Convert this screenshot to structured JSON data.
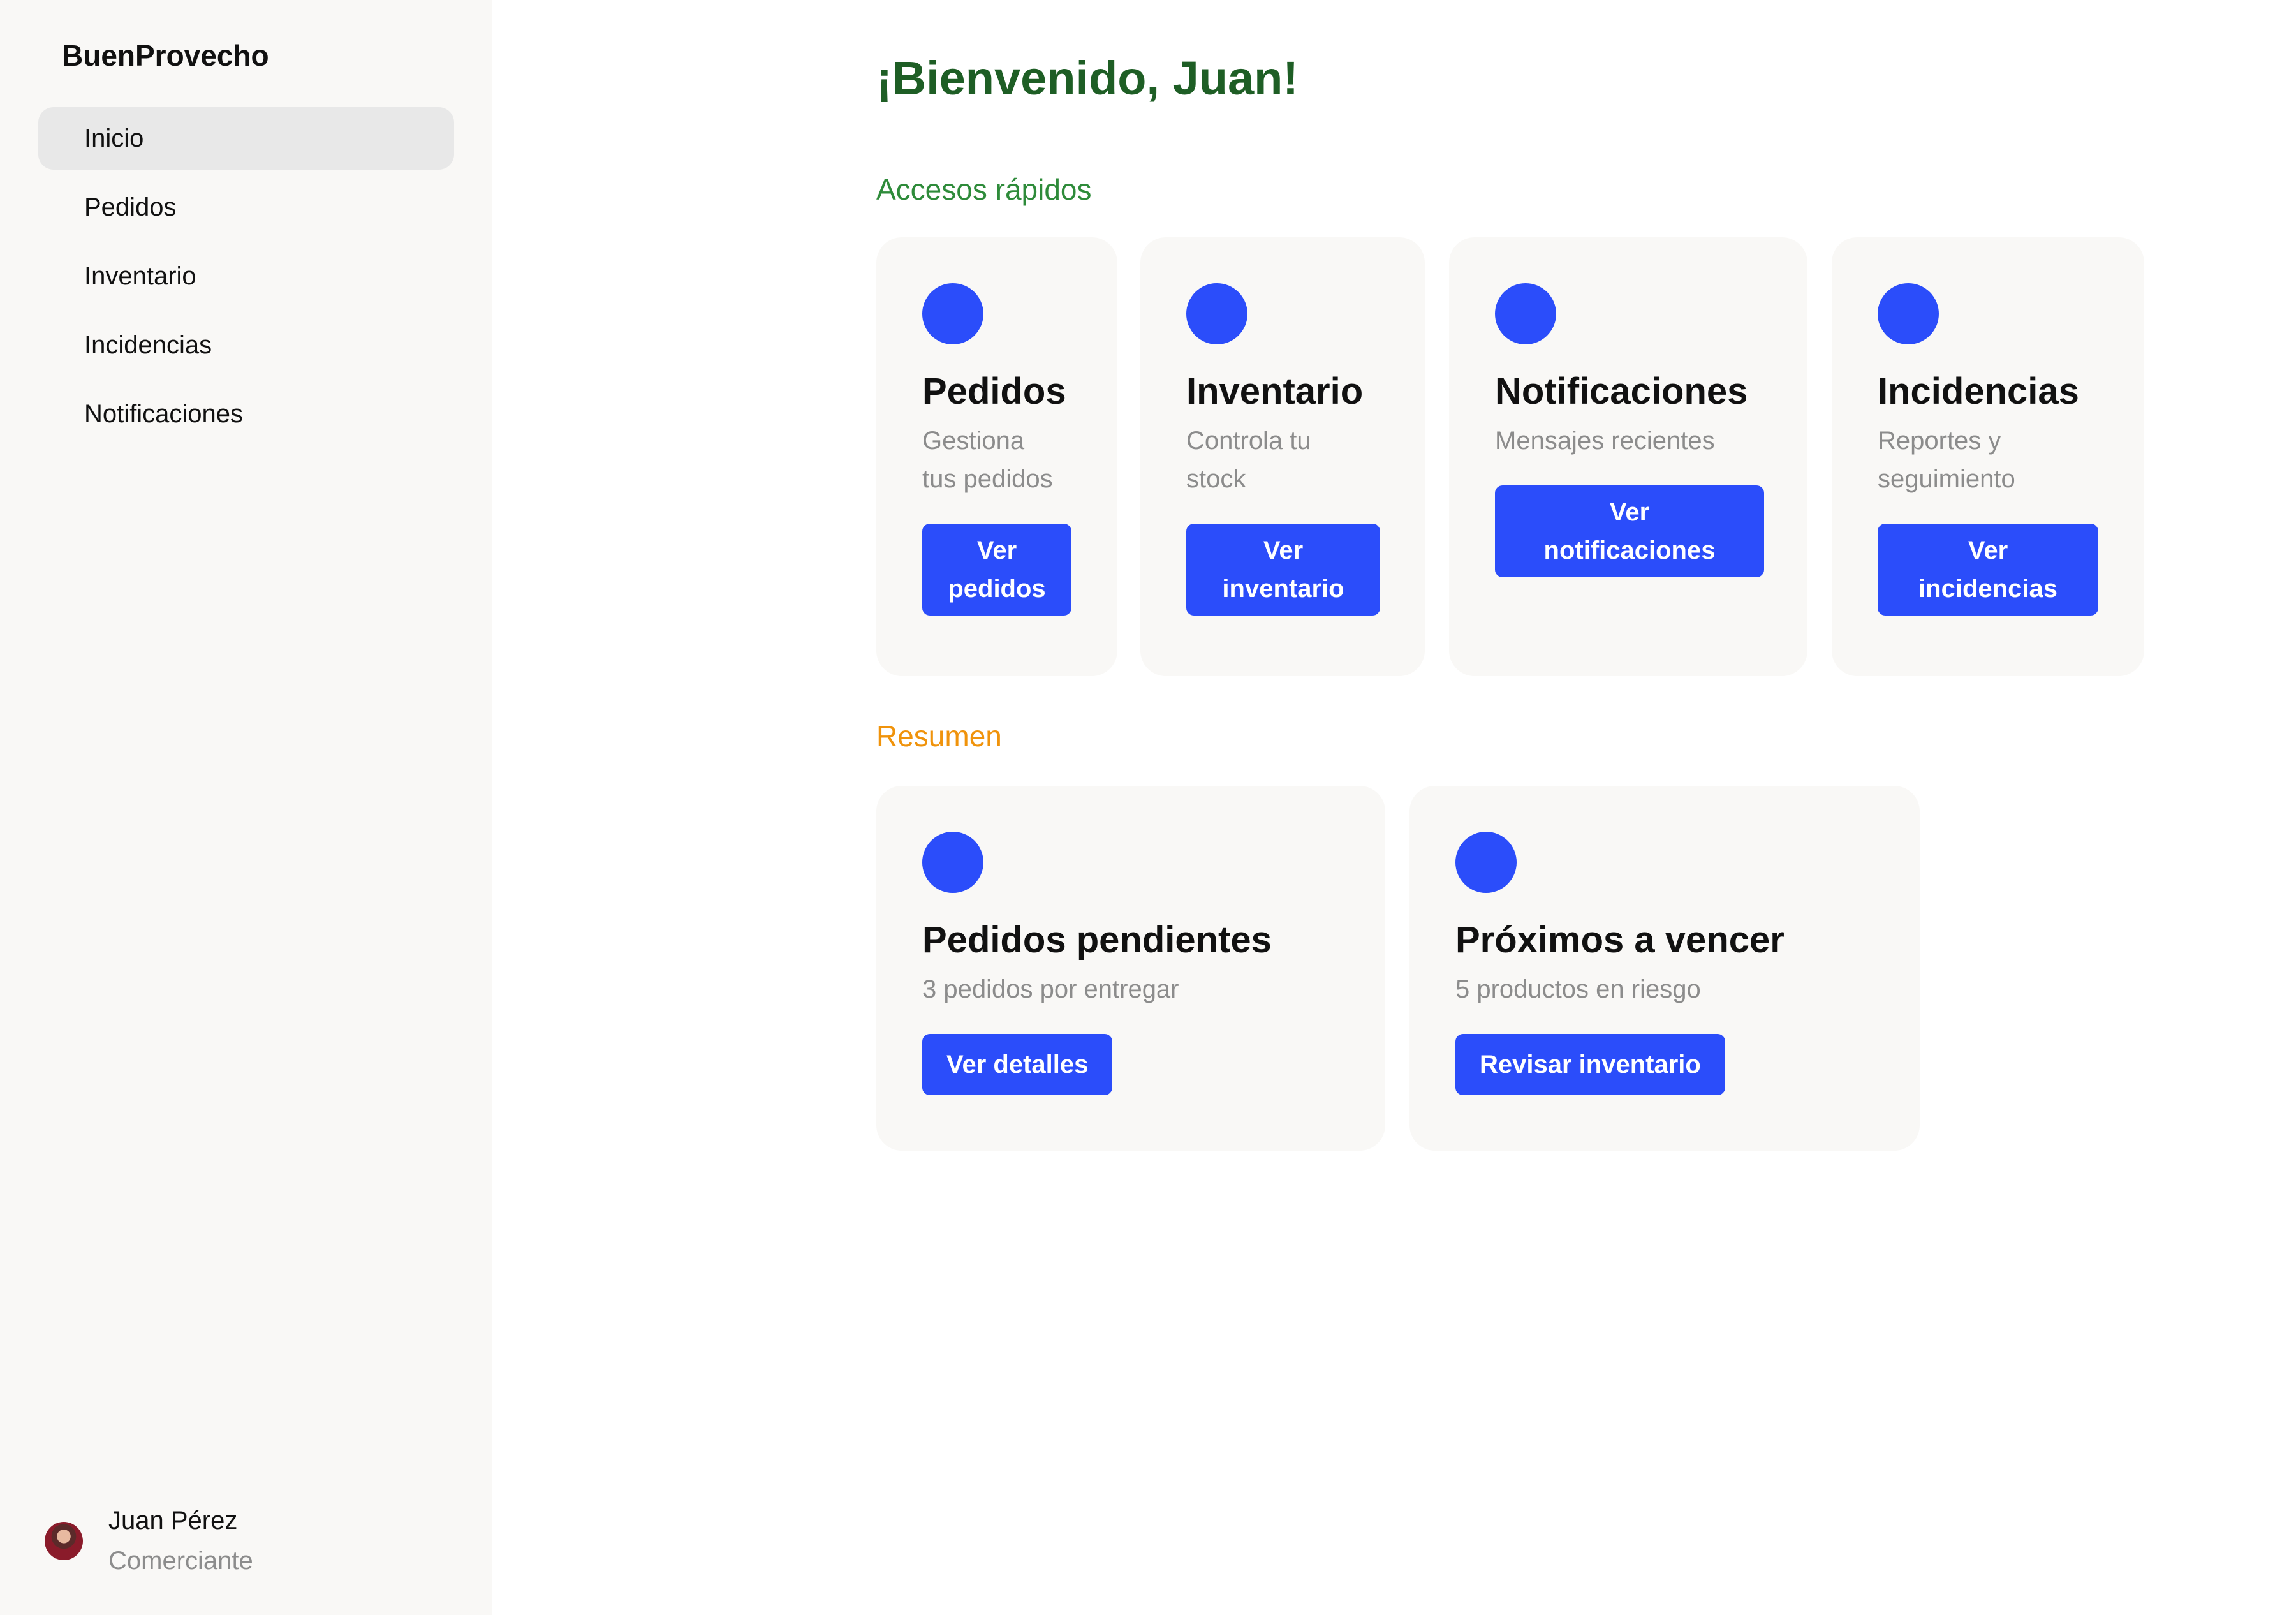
{
  "sidebar": {
    "brand": "BuenProvecho",
    "items": [
      {
        "label": "Inicio"
      },
      {
        "label": "Pedidos"
      },
      {
        "label": "Inventario"
      },
      {
        "label": "Incidencias"
      },
      {
        "label": "Notificaciones"
      }
    ],
    "active_item": "Inicio",
    "profile": {
      "name": "Juan Pérez",
      "role": "Comerciante"
    }
  },
  "main": {
    "welcome": "¡Bienvenido, Juan!",
    "quick_access": {
      "title": "Accesos rápidos",
      "cards": [
        {
          "title": "Pedidos",
          "desc_line1": "Gestiona",
          "desc_line2": "tus pedidos",
          "button_line1": "Ver",
          "button_line2": "pedidos"
        },
        {
          "title": "Inventario",
          "desc_line1": "Controla tu",
          "desc_line2": "stock",
          "button_line1": "Ver",
          "button_line2": "inventario"
        },
        {
          "title": "Notificaciones",
          "desc_line1": "Mensajes recientes",
          "button_line1": "Ver",
          "button_line2": "notificaciones"
        },
        {
          "title": "Incidencias",
          "desc_line1": "Reportes y",
          "desc_line2": "seguimiento",
          "button_line1": "Ver",
          "button_line2": "incidencias"
        }
      ]
    },
    "summary": {
      "title": "Resumen",
      "cards": [
        {
          "title": "Pedidos pendientes",
          "desc": "3 pedidos por entregar",
          "button": "Ver detalles"
        },
        {
          "title": "Próximos a vencer",
          "desc": "5 productos en riesgo",
          "button": "Revisar inventario"
        }
      ]
    }
  },
  "colors": {
    "accent": "#2b4dfa",
    "welcome": "#1e5e25",
    "quick_title": "#2e8b3a",
    "summary_title": "#f0930b",
    "sidebar_bg": "#f9f8f6"
  }
}
